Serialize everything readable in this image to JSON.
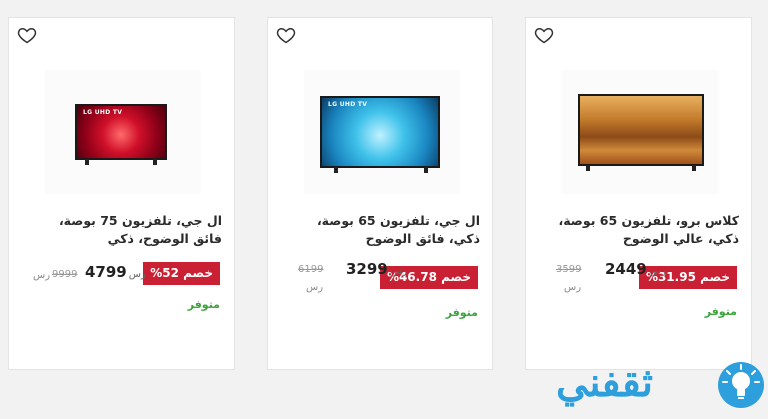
{
  "products": [
    {
      "title": "ال جي، تلفزيون 75 بوصة، فائق الوضوح، ذكي",
      "brand": "LG UHD TV",
      "discount": "%52 خصم",
      "price": "4799",
      "currency": "رس",
      "old_price": "9999",
      "old_currency": "رس",
      "stock": "متوفر"
    },
    {
      "title": "ال جي، تلفزيون 65 بوصة، ذكي، فائق الوضوح",
      "brand": "LG UHD TV",
      "discount": "%46.78 خصم",
      "price": "3299",
      "currency": "رس",
      "old_price": "6199",
      "old_currency": "رس",
      "stock": "متوفر"
    },
    {
      "title": "كلاس برو، تلفزيون 65 بوصة، ذكي، عالي الوضوح",
      "brand": "",
      "discount": "%31.95 خصم",
      "price": "2449",
      "currency": "رس",
      "old_price": "3599",
      "old_currency": "رس",
      "stock": "متوفر"
    }
  ],
  "icons": {
    "favorite": "heart-outline-icon",
    "logo_bulb": "lightbulb-icon"
  },
  "watermark": {
    "text": "ثقفني"
  },
  "colors": {
    "discount_bg": "#c92033",
    "stock": "#3aa33c",
    "logo": "#2d9fdc"
  }
}
